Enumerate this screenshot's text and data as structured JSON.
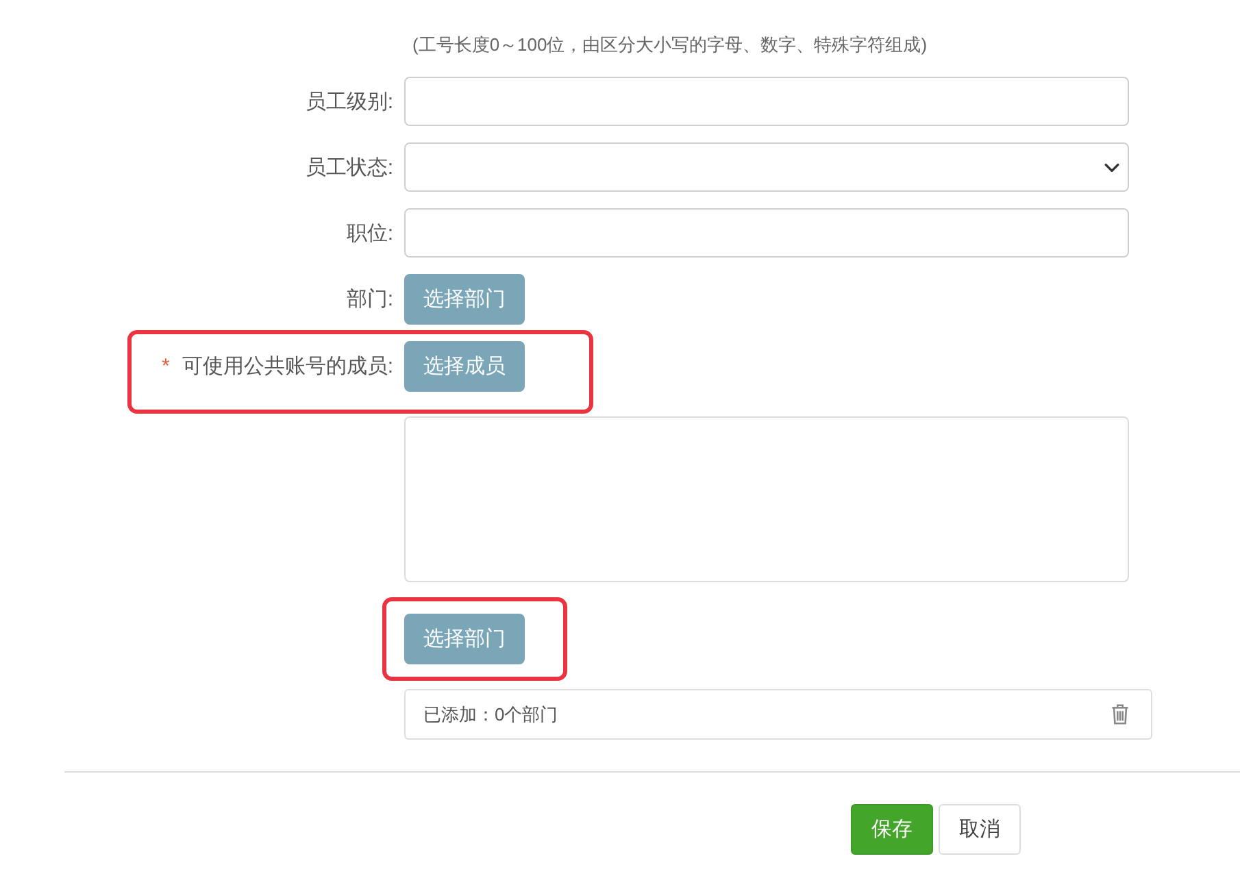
{
  "hint": "(工号长度0～100位，由区分大小写的字母、数字、特殊字符组成)",
  "fields": [
    {
      "kind": "input",
      "label": "员工级别:",
      "highlighted": false
    },
    {
      "kind": "select",
      "label": "员工状态:",
      "highlighted": false
    },
    {
      "kind": "input",
      "label": "职位:",
      "highlighted": false
    },
    {
      "kind": "button",
      "label": "部门:",
      "button": "选择部门",
      "highlighted": false
    },
    {
      "kind": "button",
      "label": "可使用公共账号的成员:",
      "required_mark": "*",
      "button": "选择成员",
      "highlighted": true
    },
    {
      "kind": "textarea",
      "highlighted": false
    },
    {
      "kind": "button",
      "button": "选择部门",
      "highlighted": true
    },
    {
      "kind": "summary",
      "text": "已添加：0个部门",
      "highlighted": false
    }
  ],
  "actions": [
    {
      "kind": "primary",
      "label": "保存"
    },
    {
      "kind": "default",
      "label": "取消"
    }
  ]
}
